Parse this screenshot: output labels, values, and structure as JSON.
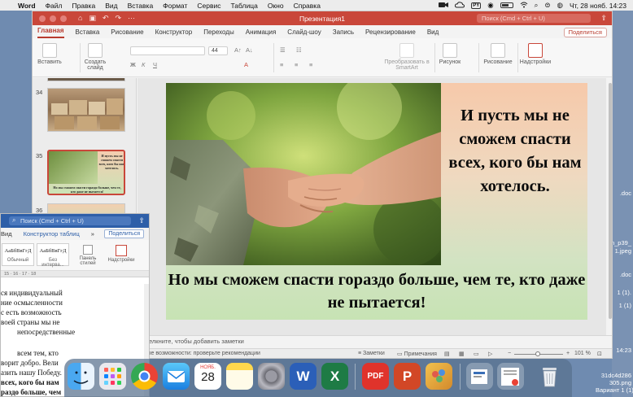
{
  "menubar": {
    "app_name": "Word",
    "items": [
      "Файл",
      "Правка",
      "Вид",
      "Вставка",
      "Формат",
      "Сервис",
      "Таблица",
      "Окно",
      "Справка"
    ],
    "clock": "Чт, 28 нояб. 14:23",
    "input_badge": "PY"
  },
  "desktop": {
    "files": [
      ".doc",
      "n_p39_",
      "1.jpeg",
      ".doc",
      "1 (1).",
      "1 (1)",
      "31dc4d286",
      "305.png",
      "Вариант 1 (1)",
      "14:23"
    ]
  },
  "ppt": {
    "title": "Презентация1",
    "search_placeholder": "Поиск (Cmd + Ctrl + U)",
    "tabs": [
      "Главная",
      "Вставка",
      "Рисование",
      "Конструктор",
      "Переходы",
      "Анимация",
      "Слайд-шоу",
      "Запись",
      "Рецензирование",
      "Вид"
    ],
    "active_tab": "Главная",
    "share_label": "Поделиться",
    "ribbon": {
      "paste": "Вставить",
      "new_slide": "Создать слайд",
      "font_size": "44",
      "smartart": "Преобразовать в SmartArt",
      "picture": "Рисунок",
      "drawing": "Рисование",
      "addins": "Надстройки"
    },
    "thumbnails": [
      {
        "num": "34"
      },
      {
        "num": "35",
        "selected": true,
        "title": "И пусть мы не сможем спасти всех, кого бы нам хотелось.",
        "caption": "Но мы сможем спасти гораздо больше, чем те, кто даже не пытается!"
      },
      {
        "num": "36"
      }
    ],
    "slide": {
      "right_text": "И пусть мы не сможем спасти всех, кого бы нам хотелось.",
      "bottom_text": "Но мы сможем спасти гораздо больше, чем те, кто даже не пытается!"
    },
    "notes_placeholder": "елкните, чтобы добавить заметки",
    "status": {
      "accessibility": "ьные возможности: проверьте рекомендации",
      "notes_btn": "Заметки",
      "comments_btn": "Примечания",
      "zoom": "101 %"
    },
    "colors": {
      "accent": "#c9473a"
    }
  },
  "word": {
    "search_placeholder": "Поиск (Cmd + Ctrl + U)",
    "tab_view": "Вид",
    "tab_table_design": "Конструктор таблиц",
    "share_label": "Поделиться",
    "style1_sample": "АаБбВвГгД",
    "style1_name": "Обычный",
    "style2_sample": "АаБбВвГгД",
    "style2_name": "Без интерва...",
    "styles_pane": "Панель стилей",
    "addins": "Надстройки",
    "ruler": "15  ·  16  ·  17  ·  18",
    "doc_lines": [
      "ся индивидуальный",
      "ние осмысленности",
      "с есть возможность",
      "воей страны мы не",
      "непосредственные",
      "",
      "всем   тем,   кто",
      "ворит добро. Вели",
      "азить нашу Победу.",
      "всех, кого бы нам",
      "раздо больше, чем"
    ],
    "colors": {
      "accent": "#2e5fa8"
    }
  },
  "dock": {
    "apps": [
      "finder-icon",
      "launchpad-icon",
      "chrome-icon",
      "mail-icon",
      "calendar-icon",
      "notes-icon",
      "settings-icon",
      "word-icon",
      "excel-icon",
      "pdf-icon",
      "powerpoint-icon",
      "photos-icon",
      "downloads-icon",
      "docs-icon",
      "trash-icon"
    ],
    "calendar_month": "НОЯБ.",
    "calendar_day": "28",
    "pdf_label": "PDF"
  }
}
